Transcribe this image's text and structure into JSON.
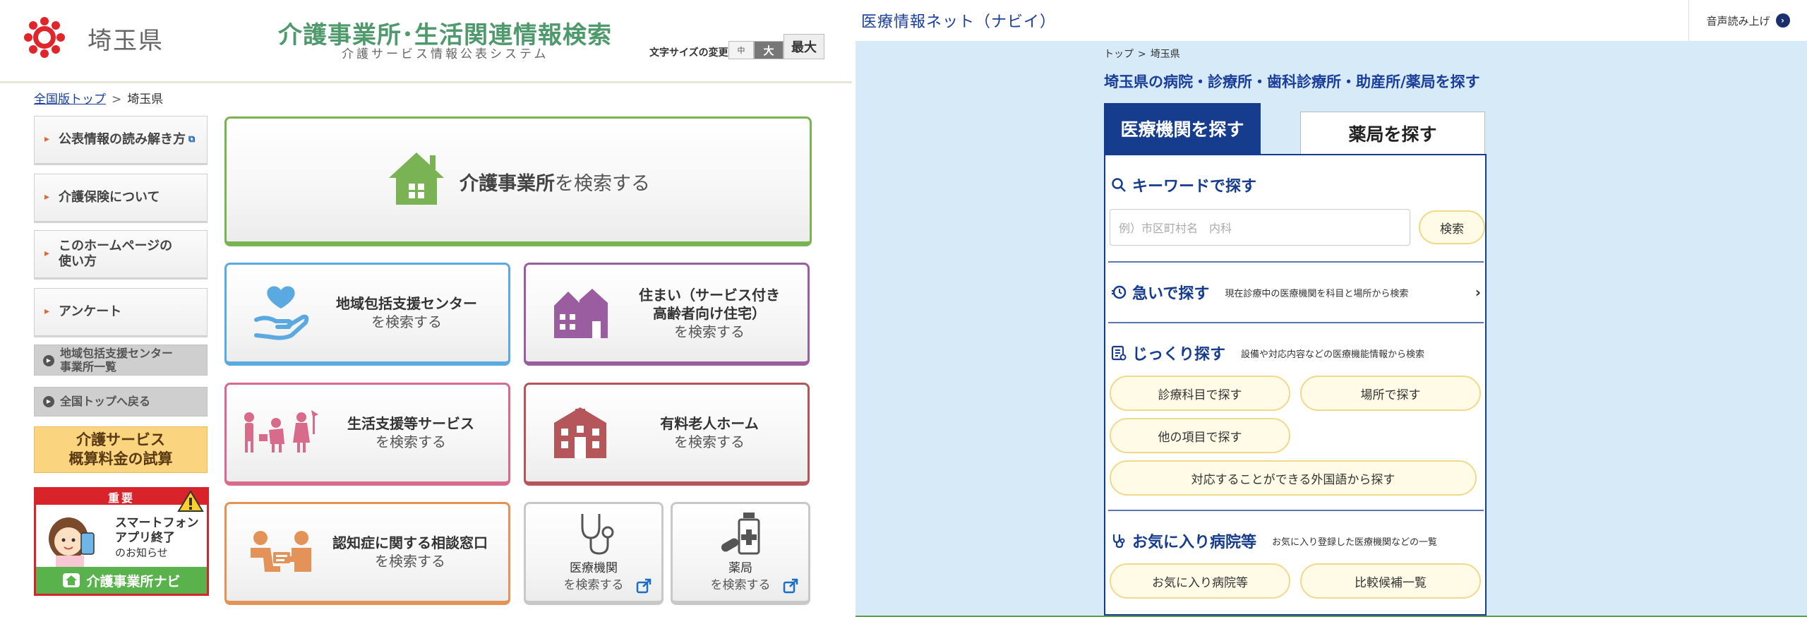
{
  "left": {
    "pref_name": "埼玉県",
    "site_title": "介護事業所･生活関連情報検索",
    "site_sub": "介護サービス情報公表システム",
    "font_size": {
      "label": "文字サイズの変更",
      "mid": "中",
      "large": "大",
      "max": "最大"
    },
    "breadcrumb": {
      "top": "全国版トップ",
      "sep": ">",
      "current": "埼玉県"
    },
    "side": {
      "read_guide": "公表情報の読み解き方",
      "insurance": "介護保険について",
      "howto_1": "このホームページの",
      "howto_2": "使い方",
      "survey": "アンケート",
      "center_list_1": "地域包括支援センター",
      "center_list_2": "事業所一覧",
      "back_top": "全国トップへ戻る",
      "calc_1": "介護サービス",
      "calc_2": "概算料金の試算"
    },
    "notice": {
      "badge": "重要",
      "line1": "スマートフォン",
      "line2": "アプリ終了",
      "line3": "のお知らせ",
      "foot": "介護事業所ナビ"
    },
    "tiles": {
      "main_bold": "介護事業所",
      "main_rest": "を検索する",
      "search_suffix": "を検索する",
      "center": "地域包括支援センター",
      "housing_1": "住まい（サービス付き",
      "housing_2": "高齢者向け住宅）",
      "life": "生活支援等サービス",
      "home": "有料老人ホーム",
      "dementia": "認知症に関する相談窓口",
      "hospital": "医療機関",
      "pharmacy": "薬局"
    },
    "colors": {
      "green": "#79b354",
      "blue": "#5aa9e0",
      "purple": "#9a5d9f",
      "pink": "#d86a8c",
      "brown": "#b4565a",
      "orange": "#e39357"
    }
  },
  "right": {
    "title": "医療情報ネット（ナビイ）",
    "voice": "音声読み上げ",
    "breadcrumb": {
      "top": "トップ",
      "sep": ">",
      "current": "埼玉県"
    },
    "heading": "埼玉県の病院・診療所・歯科診療所・助産所/薬局を探す",
    "tabs": {
      "medical": "医療機関を探す",
      "pharmacy": "薬局を探す"
    },
    "keyword": {
      "title": "キーワードで探す",
      "placeholder": "例）市区町村名　内科",
      "button": "検索"
    },
    "urgent": {
      "title": "急いで探す",
      "desc": "現在診療中の医療機関を科目と場所から検索"
    },
    "detail": {
      "title": "じっくり探す",
      "desc": "設備や対応内容などの医療機能情報から検索",
      "by_dept": "診療科目で探す",
      "by_place": "場所で探す",
      "by_other": "他の項目で探す",
      "by_lang": "対応することができる外国語から探す"
    },
    "favorite": {
      "title": "お気に入り病院等",
      "desc": "お気に入り登録した医療機関などの一覧",
      "fav": "お気に入り病院等",
      "compare": "比較候補一覧"
    },
    "colors": {
      "navy": "#163c8e",
      "bg": "#d6eaf8",
      "pill": "#fffbe6"
    }
  }
}
